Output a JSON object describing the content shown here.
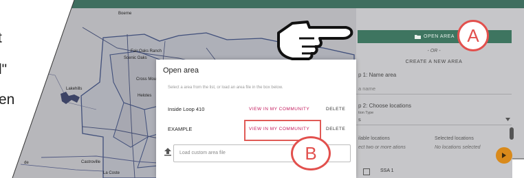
{
  "doc_fragment": {
    "lines": [
      "t",
      "l\"",
      "en"
    ]
  },
  "map": {
    "places": [
      "Boerne",
      "Fair Oaks Ranch",
      "Scenic Oaks",
      "Cross Mountain",
      "Helotes",
      "Lakehills",
      "Castroville",
      "La Coste",
      "de"
    ]
  },
  "side_panel": {
    "open_area_label": "OPEN AREA",
    "or_label": "- OR -",
    "create_label": "CREATE A NEW AREA",
    "step1": "p 1: Name area",
    "name_placeholder": "a name",
    "step2": "p 2: Choose locations",
    "location_type_label": "tion Type",
    "location_type_value": "s",
    "available_header": "ilable locations",
    "available_hint": "ect two or more ations",
    "selected_header": "Selected locations",
    "selected_hint": "No locations selected",
    "list_item": "SSA 1"
  },
  "dialog": {
    "title": "Open area",
    "subtitle": "Select a area from the list, or load an area file in the box below.",
    "rows": [
      {
        "name": "Inside Loop 410",
        "view": "VIEW IN MY COMMUNITY",
        "delete": "DELETE"
      },
      {
        "name": "EXAMPLE",
        "view": "VIEW IN MY COMMUNITY",
        "delete": "DELETE"
      }
    ],
    "load_placeholder": "Load custom area file"
  },
  "callouts": {
    "a": "A",
    "b": "B"
  },
  "colors": {
    "accent_green": "#3e7560",
    "link_pink": "#c2185b",
    "callout_red": "#e2504d",
    "fab_orange": "#d98a1b"
  },
  "icons": [
    "folder-icon",
    "upload-icon",
    "pointing-hand-icon",
    "chevron-down-icon",
    "checkbox-icon"
  ]
}
